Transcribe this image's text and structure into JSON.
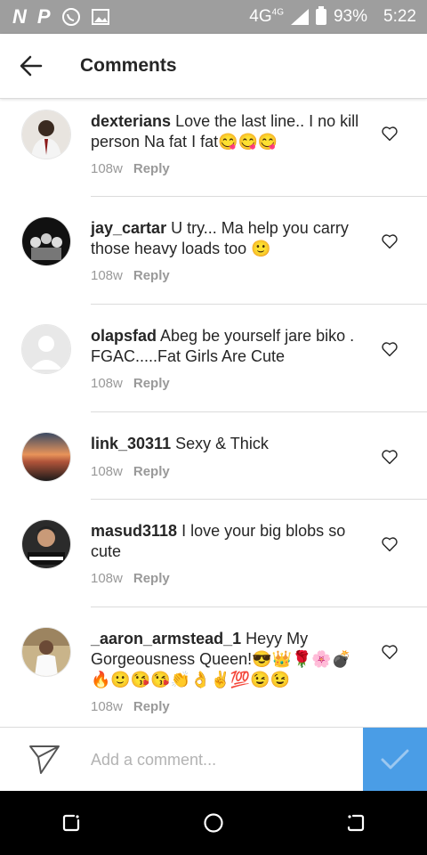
{
  "status_bar": {
    "network": "4G",
    "network_sup": "4G",
    "battery": "93%",
    "time": "5:22"
  },
  "header": {
    "title": "Comments"
  },
  "comments": [
    {
      "username": "dexterians",
      "text": "Love the last line.. I no kill person Na fat I fat😋😋😋",
      "age": "108w",
      "reply_label": "Reply"
    },
    {
      "username": "jay_cartar",
      "text": "U try... Ma help you carry those heavy  loads too 🙂",
      "age": "108w",
      "reply_label": "Reply"
    },
    {
      "username": "olapsfad",
      "text": "Abeg be yourself jare biko . FGAC.....Fat Girls Are Cute",
      "age": "108w",
      "reply_label": "Reply"
    },
    {
      "username": "link_30311",
      "text": "Sexy & Thick",
      "age": "108w",
      "reply_label": "Reply"
    },
    {
      "username": "masud3118",
      "text": "I love your big blobs so cute",
      "age": "108w",
      "reply_label": "Reply"
    },
    {
      "username": "_aaron_armstead_1",
      "text": "Heyy My Gorgeousness Queen!😎👑🌹🌸💣🔥🙂😘😘👏👌✌💯😉😉",
      "age": "108w",
      "reply_label": "Reply"
    }
  ],
  "composer": {
    "placeholder": "Add a comment..."
  },
  "colors": {
    "post_button": "#4a9de6",
    "status_bar": "#9e9e9e"
  }
}
